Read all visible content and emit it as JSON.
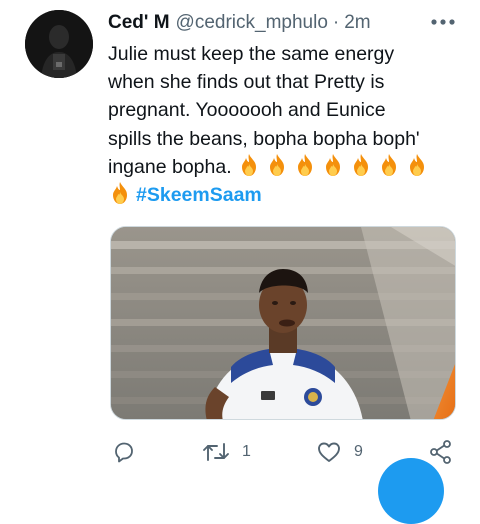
{
  "tweet": {
    "display_name": "Ced' M",
    "handle": "@cedrick_mphulo",
    "separator": "·",
    "time": "2m",
    "text_lines": [
      "Julie must keep the same energy",
      "when she finds out that Pretty is",
      "pregnant. Yooooooh and Eunice",
      "spills the beans, bopha bopha boph'",
      "ingane bopha."
    ],
    "hashtag": "#SkeemSaam"
  },
  "actions": {
    "reply_count": "",
    "retweet_count": "1",
    "like_count": "9"
  },
  "icons": {
    "more": "more-horizontal-icon",
    "reply": "reply-icon",
    "retweet": "retweet-icon",
    "like": "heart-icon",
    "share": "share-icon"
  },
  "colors": {
    "accent": "#1d9bf0",
    "text": "#0f1419",
    "secondary": "#536471"
  }
}
